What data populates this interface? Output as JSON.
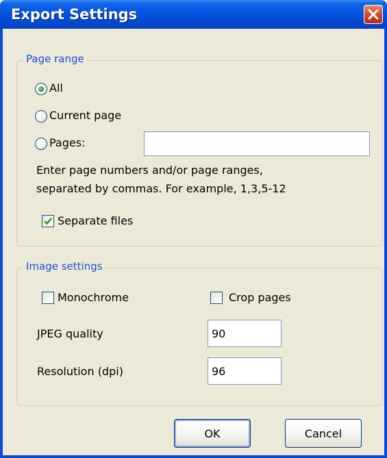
{
  "window": {
    "title": "Export Settings",
    "close_icon": "close-icon"
  },
  "page_range": {
    "legend": "Page range",
    "options": [
      {
        "label": "All",
        "selected": true
      },
      {
        "label": "Current page",
        "selected": false
      },
      {
        "label": "Pages:",
        "selected": false
      }
    ],
    "pages_input_value": "",
    "help_line1": "Enter page numbers and/or page ranges,",
    "help_line2": "separated by commas. For example, 1,3,5-12",
    "separate_files": {
      "label": "Separate files",
      "checked": true
    }
  },
  "image_settings": {
    "legend": "Image settings",
    "monochrome": {
      "label": "Monochrome",
      "checked": false
    },
    "crop_pages": {
      "label": "Crop pages",
      "checked": false
    },
    "jpeg_quality": {
      "label": "JPEG quality",
      "value": "90"
    },
    "resolution": {
      "label": "Resolution (dpi)",
      "value": "96"
    }
  },
  "buttons": {
    "ok": "OK",
    "cancel": "Cancel"
  },
  "colors": {
    "title_bar": "#0553E0",
    "dialog_bg": "#ECE9D8",
    "group_legend": "#1553D9",
    "close_button": "#D2452A",
    "radio_dot": "#21A121",
    "checkmark": "#21A121"
  }
}
